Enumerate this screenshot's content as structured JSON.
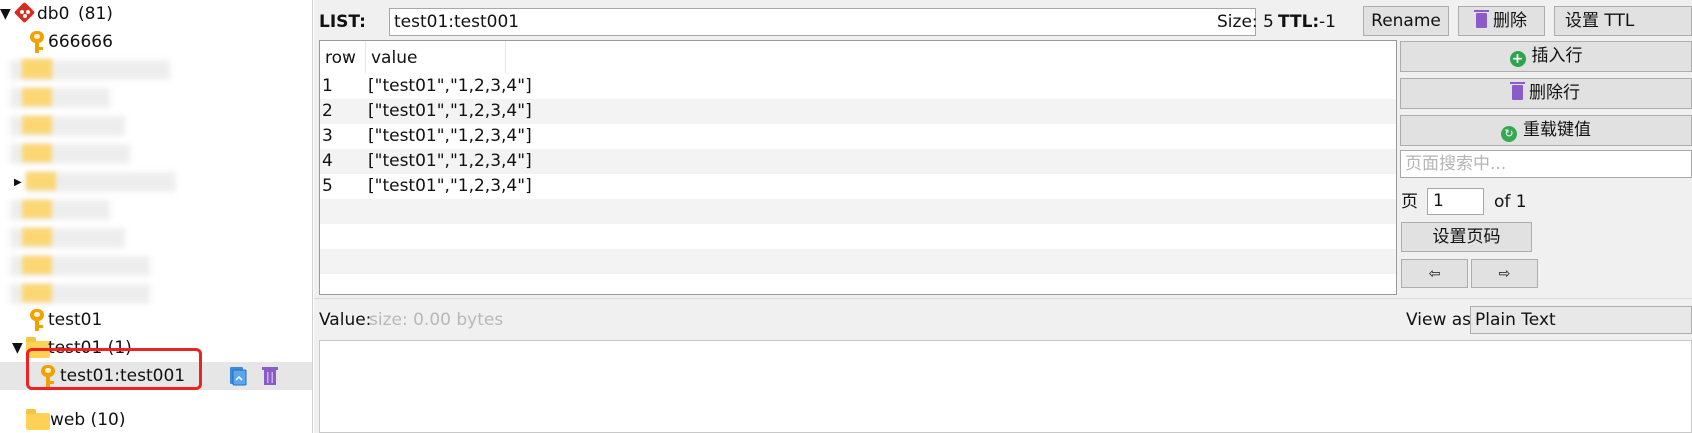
{
  "tree": {
    "db": {
      "name": "db0",
      "count": "(81)"
    },
    "items": {
      "key_666666": "666666",
      "key_test01": "test01",
      "folder_test01": "test01 (1)",
      "selected_key": "test01:test001",
      "folder_web": "web (10)"
    }
  },
  "header": {
    "type_label": "LIST:",
    "key_name": "test01:test001",
    "size_label": "Size: 5",
    "ttl_label": "TTL:",
    "ttl_value": "-1",
    "rename_label": "Rename",
    "delete_label": "删除",
    "set_ttl_label": "设置 TTL"
  },
  "table": {
    "columns": [
      "row",
      "value"
    ],
    "rows": [
      {
        "row": "1",
        "value": "[\"test01\",\"1,2,3,4\"]"
      },
      {
        "row": "2",
        "value": "[\"test01\",\"1,2,3,4\"]"
      },
      {
        "row": "3",
        "value": "[\"test01\",\"1,2,3,4\"]"
      },
      {
        "row": "4",
        "value": "[\"test01\",\"1,2,3,4\"]"
      },
      {
        "row": "5",
        "value": "[\"test01\",\"1,2,3,4\"]"
      }
    ]
  },
  "sidebar_actions": {
    "insert_row": "插入行",
    "delete_row": "删除行",
    "reload_value": "重载键值",
    "search_placeholder": "页面搜索中...",
    "page_label": "页",
    "page_value": "1",
    "of_label": "of 1",
    "set_page": "设置页码",
    "prev_arrow": "⇦",
    "next_arrow": "⇨"
  },
  "value_section": {
    "label": "Value:",
    "size_hint": "size: 0.00 bytes",
    "view_as_label": "View as:",
    "view_as_value": "Plain Text"
  },
  "colors": {
    "selection_outline": "#ee2222",
    "folder": "#ffd256",
    "key": "#f2a100",
    "trash": "#8b5cc8",
    "redis": "#d82c20"
  }
}
